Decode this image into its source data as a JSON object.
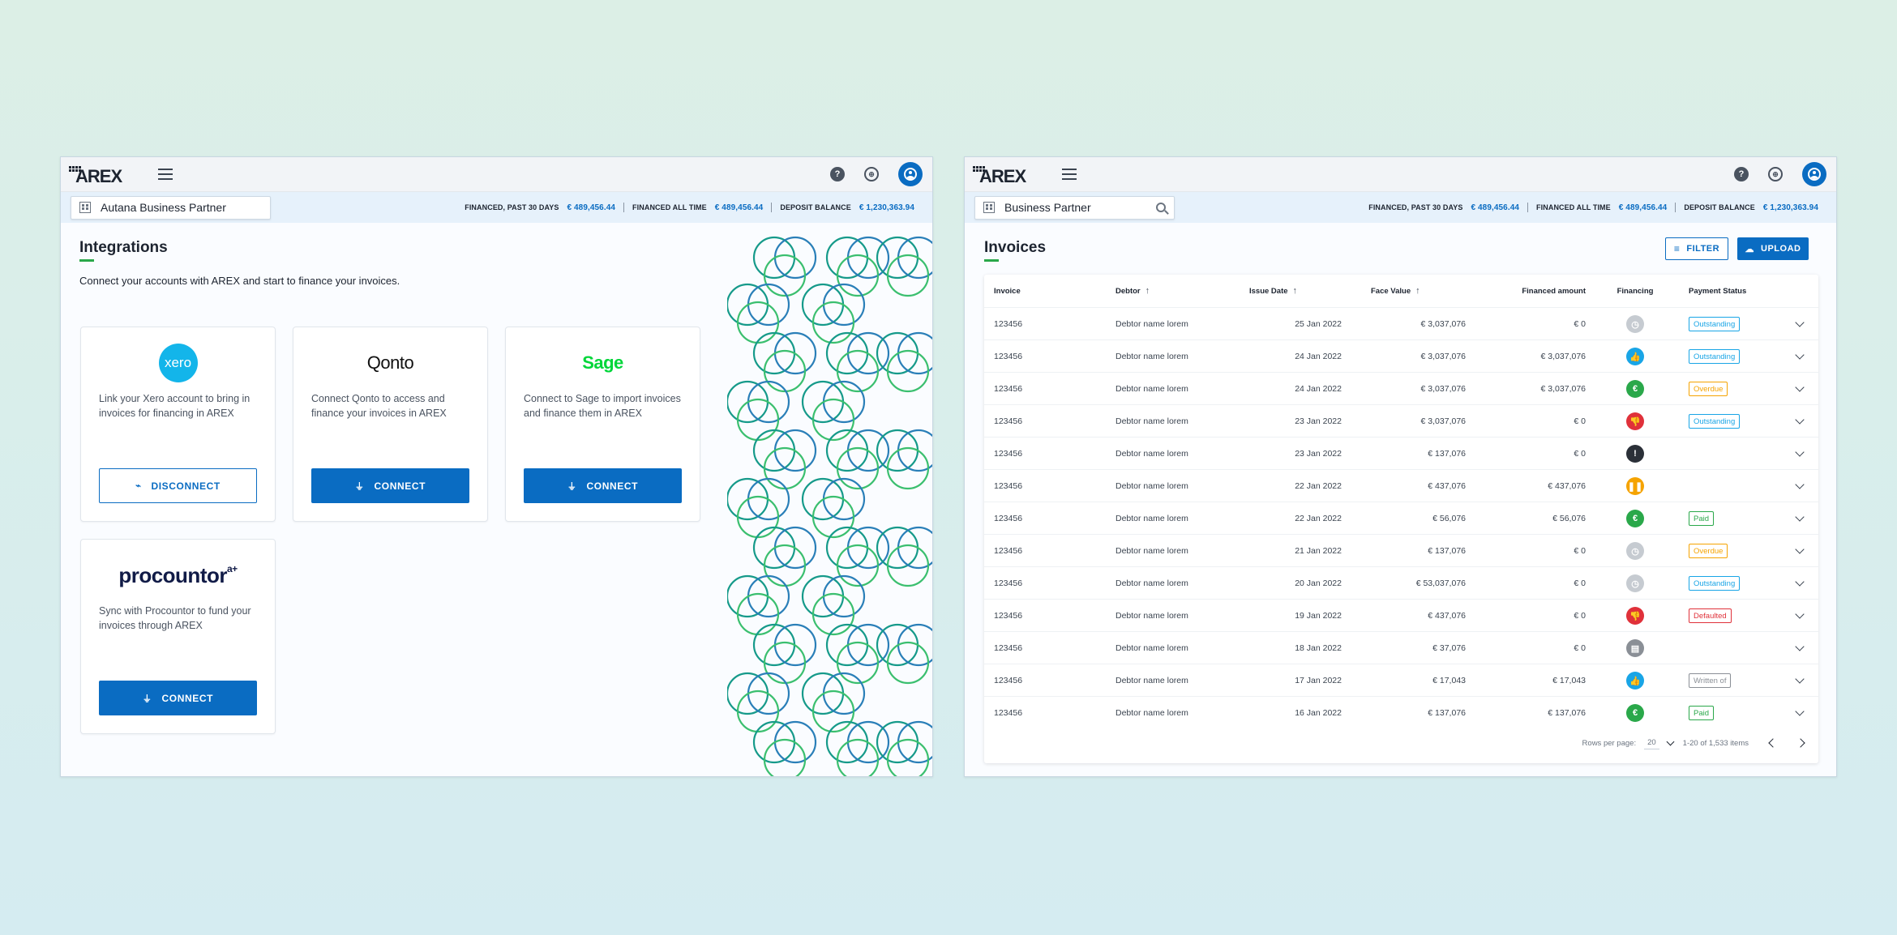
{
  "brand": {
    "logo_text": "AREX"
  },
  "header": {
    "help_icon": "help-icon",
    "globe_icon": "globe-icon",
    "avatar_icon": "account-icon"
  },
  "colors": {
    "primary": "#0a6cc2",
    "accent_green": "#2aa84a",
    "outstanding": "#19a5e6",
    "overdue": "#f5a300",
    "paid": "#2aa84a",
    "defaulted": "#e0313a",
    "written_off": "#8a8f96"
  },
  "left_window": {
    "partner": "Autana Business Partner",
    "stats": [
      {
        "label": "FINANCED, PAST 30 DAYS",
        "value": "€ 489,456.44"
      },
      {
        "label": "FINANCED ALL TIME",
        "value": "€ 489,456.44"
      },
      {
        "label": "DEPOSIT BALANCE",
        "value": "€ 1,230,363.94"
      }
    ],
    "title": "Integrations",
    "description": "Connect your accounts with AREX and start to finance your invoices.",
    "cards": [
      {
        "brand": "xero",
        "description": "Link your Xero account to bring in invoices for financing in AREX",
        "button": "DISCONNECT"
      },
      {
        "brand": "Qonto",
        "description": "Connect Qonto to access and finance your invoices in AREX",
        "button": "CONNECT"
      },
      {
        "brand": "Sage",
        "description": "Connect to Sage to import invoices and finance them in AREX",
        "button": "CONNECT"
      },
      {
        "brand": "procountor",
        "brand_sup": "a+",
        "description": "Sync with Procountor to fund your invoices through AREX",
        "button": "CONNECT"
      }
    ]
  },
  "right_window": {
    "partner": "Business Partner",
    "stats": [
      {
        "label": "FINANCED, PAST 30 DAYS",
        "value": "€ 489,456.44"
      },
      {
        "label": "FINANCED ALL TIME",
        "value": "€ 489,456.44"
      },
      {
        "label": "DEPOSIT BALANCE",
        "value": "€ 1,230,363.94"
      }
    ],
    "title": "Invoices",
    "filter_label": "FILTER",
    "upload_label": "UPLOAD",
    "columns": [
      "Invoice",
      "Debtor",
      "Issue Date",
      "Face Value",
      "Financed amount",
      "Financing",
      "Payment Status"
    ],
    "rows": [
      {
        "invoice": "123456",
        "debtor": "Debtor name lorem",
        "issue": "25 Jan 2022",
        "face": "€ 3,037,076",
        "financed": "€ 0",
        "financing": "pending",
        "status": "Outstanding"
      },
      {
        "invoice": "123456",
        "debtor": "Debtor name lorem",
        "issue": "24 Jan 2022",
        "face": "€ 3,037,076",
        "financed": "€ 3,037,076",
        "financing": "approved",
        "status": "Outstanding"
      },
      {
        "invoice": "123456",
        "debtor": "Debtor name lorem",
        "issue": "24 Jan 2022",
        "face": "€ 3,037,076",
        "financed": "€ 3,037,076",
        "financing": "financed",
        "status": "Overdue"
      },
      {
        "invoice": "123456",
        "debtor": "Debtor name lorem",
        "issue": "23 Jan 2022",
        "face": "€ 3,037,076",
        "financed": "€ 0",
        "financing": "rejected",
        "status": "Outstanding"
      },
      {
        "invoice": "123456",
        "debtor": "Debtor name lorem",
        "issue": "23 Jan 2022",
        "face": "€ 137,076",
        "financed": "€ 0",
        "financing": "info",
        "status": ""
      },
      {
        "invoice": "123456",
        "debtor": "Debtor name lorem",
        "issue": "22 Jan 2022",
        "face": "€ 437,076",
        "financed": "€ 437,076",
        "financing": "paused",
        "status": ""
      },
      {
        "invoice": "123456",
        "debtor": "Debtor name lorem",
        "issue": "22 Jan 2022",
        "face": "€ 56,076",
        "financed": "€ 56,076",
        "financing": "financed",
        "status": "Paid"
      },
      {
        "invoice": "123456",
        "debtor": "Debtor name lorem",
        "issue": "21 Jan 2022",
        "face": "€ 137,076",
        "financed": "€ 0",
        "financing": "pending",
        "status": "Overdue"
      },
      {
        "invoice": "123456",
        "debtor": "Debtor name lorem",
        "issue": "20 Jan 2022",
        "face": "€ 53,037,076",
        "financed": "€ 0",
        "financing": "pending",
        "status": "Outstanding"
      },
      {
        "invoice": "123456",
        "debtor": "Debtor name lorem",
        "issue": "19 Jan 2022",
        "face": "€ 437,076",
        "financed": "€ 0",
        "financing": "rejected",
        "status": "Defaulted"
      },
      {
        "invoice": "123456",
        "debtor": "Debtor name lorem",
        "issue": "18 Jan 2022",
        "face": "€ 37,076",
        "financed": "€ 0",
        "financing": "document",
        "status": ""
      },
      {
        "invoice": "123456",
        "debtor": "Debtor name lorem",
        "issue": "17 Jan 2022",
        "face": "€ 17,043",
        "financed": "€ 17,043",
        "financing": "approved",
        "status": "Written of"
      },
      {
        "invoice": "123456",
        "debtor": "Debtor name lorem",
        "issue": "16 Jan 2022",
        "face": "€ 137,076",
        "financed": "€ 137,076",
        "financing": "financed",
        "status": "Paid"
      }
    ],
    "pager": {
      "rows_label": "Rows per page:",
      "rows_value": "20",
      "range": "1-20 of 1,533 items"
    }
  }
}
